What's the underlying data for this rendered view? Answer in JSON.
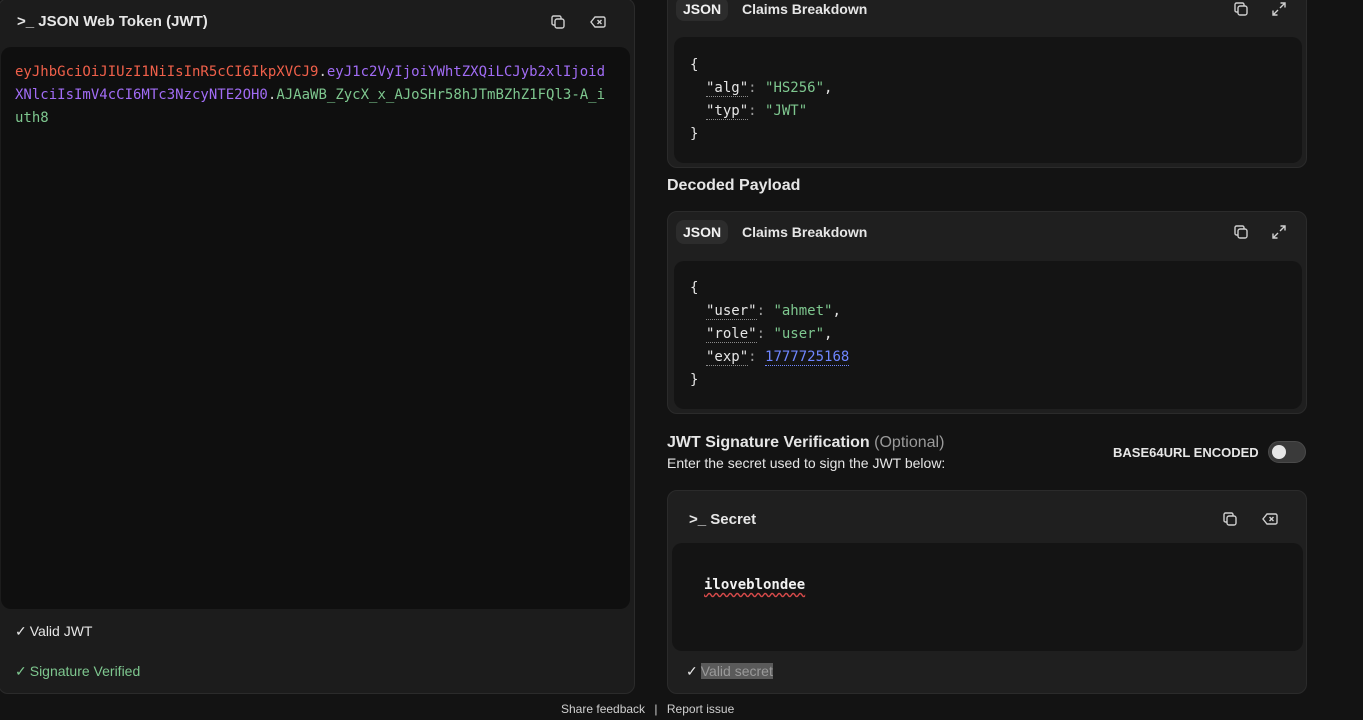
{
  "left": {
    "title": "JSON Web Token (JWT)",
    "title_prefix": ">_",
    "token": {
      "header": "eyJhbGciOiJIUzI1NiIsInR5cCI6IkpXVCJ9",
      "dot1": ".",
      "payload": "eyJ1c2VyIjoiYWhtZXQiLCJyb2xlIjoidXNlciIsImV4cCI6MTc3NzcyNTE2OH0",
      "dot2": ".",
      "signature": "AJAaWB_ZycX_x_AJoSHr58hJTmBZhZ1FQl3-A_iuth8"
    },
    "status_valid": "Valid JWT",
    "status_verified": "Signature Verified",
    "colors": {
      "header": "#f0604a",
      "payload": "#a16cf5",
      "signature": "#7ec78f"
    }
  },
  "header_block": {
    "tab_json": "JSON",
    "tab_claims": "Claims Breakdown",
    "open": "{",
    "close": "}",
    "lines": [
      {
        "key": "\"alg\"",
        "value": "\"HS256\"",
        "comma": ","
      },
      {
        "key": "\"typ\"",
        "value": "\"JWT\"",
        "comma": ""
      }
    ]
  },
  "payload_block": {
    "heading": "Decoded Payload",
    "tab_json": "JSON",
    "tab_claims": "Claims Breakdown",
    "open": "{",
    "close": "}",
    "lines": [
      {
        "key": "\"user\"",
        "value": "\"ahmet\"",
        "comma": ","
      },
      {
        "key": "\"role\"",
        "value": "\"user\"",
        "comma": ","
      },
      {
        "key": "\"exp\"",
        "value": "1777725168",
        "comma": ""
      }
    ]
  },
  "verification": {
    "heading": "JWT Signature Verification",
    "optional": "(Optional)",
    "subtitle": "Enter the secret used to sign the JWT below:",
    "toggle_label": "BASE64URL ENCODED",
    "toggle_on": false
  },
  "secret": {
    "title_prefix": ">_",
    "title": "Secret",
    "value": "iloveblondee",
    "status": "Valid secret"
  },
  "footer": {
    "share": "Share feedback",
    "sep": "|",
    "report": "Report issue"
  }
}
